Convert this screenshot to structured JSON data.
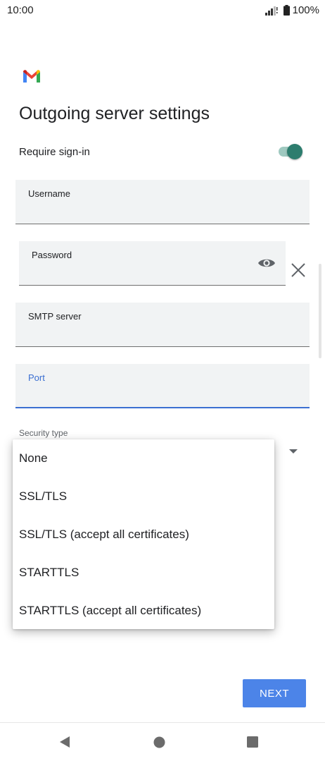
{
  "status_bar": {
    "time": "10:00",
    "battery": "100%",
    "icons": [
      "signal-icon",
      "battery-icon"
    ]
  },
  "app": {
    "logo": "gmail-logo"
  },
  "page": {
    "title": "Outgoing server settings"
  },
  "require_signin": {
    "label": "Require sign-in",
    "enabled": true
  },
  "fields": {
    "username": {
      "label": "Username",
      "value": ""
    },
    "password": {
      "label": "Password",
      "value": ""
    },
    "smtp_server": {
      "label": "SMTP server",
      "value": ""
    },
    "port": {
      "label": "Port",
      "value": ""
    }
  },
  "security_type": {
    "label": "Security type",
    "options": [
      "None",
      "SSL/TLS",
      "SSL/TLS (accept all certificates)",
      "STARTTLS",
      "STARTTLS (accept all certificates)"
    ]
  },
  "actions": {
    "next_label": "NEXT"
  },
  "navigation": {
    "icons": [
      "back-icon",
      "home-icon",
      "recents-icon"
    ]
  },
  "colors": {
    "accent": "#4c84e8",
    "toggle_on": "#2d7d6e",
    "focused_field": "#3b6fd1"
  }
}
